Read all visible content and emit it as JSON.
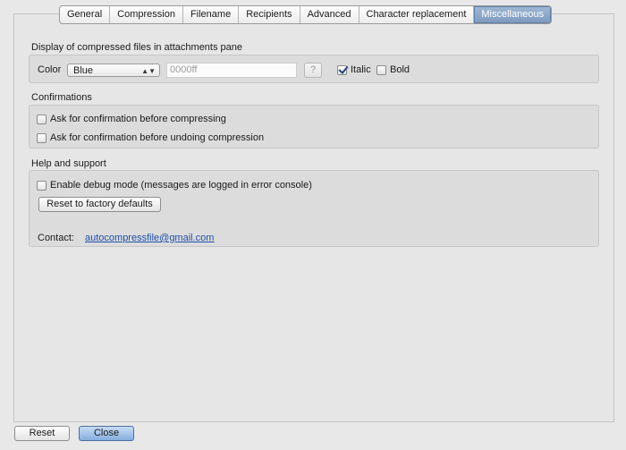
{
  "tabs": [
    {
      "label": "General"
    },
    {
      "label": "Compression"
    },
    {
      "label": "Filename"
    },
    {
      "label": "Recipients"
    },
    {
      "label": "Advanced"
    },
    {
      "label": "Character replacement"
    },
    {
      "label": "Miscellaneous",
      "active": true
    }
  ],
  "display": {
    "title": "Display of compressed files in attachments pane",
    "color_label": "Color",
    "color_value": "Blue",
    "color_hex_placeholder": "0000ff",
    "help_button": "?",
    "italic_label": "Italic",
    "italic_checked": true,
    "bold_label": "Bold",
    "bold_checked": false
  },
  "confirmations": {
    "title": "Confirmations",
    "compress_label": "Ask for confirmation before compressing",
    "undo_label": "Ask for confirmation before undoing compression"
  },
  "help": {
    "title": "Help and support",
    "debug_label": "Enable debug mode (messages are logged in error console)",
    "reset_defaults_label": "Reset to factory defaults",
    "contact_label": "Contact:",
    "contact_email": "autocompressfile@gmail.com"
  },
  "footer": {
    "reset_label": "Reset",
    "close_label": "Close"
  },
  "colors": {
    "active_tab": "#8aa4c8",
    "link": "#1f4fa8",
    "primary_button": "#86aede"
  }
}
